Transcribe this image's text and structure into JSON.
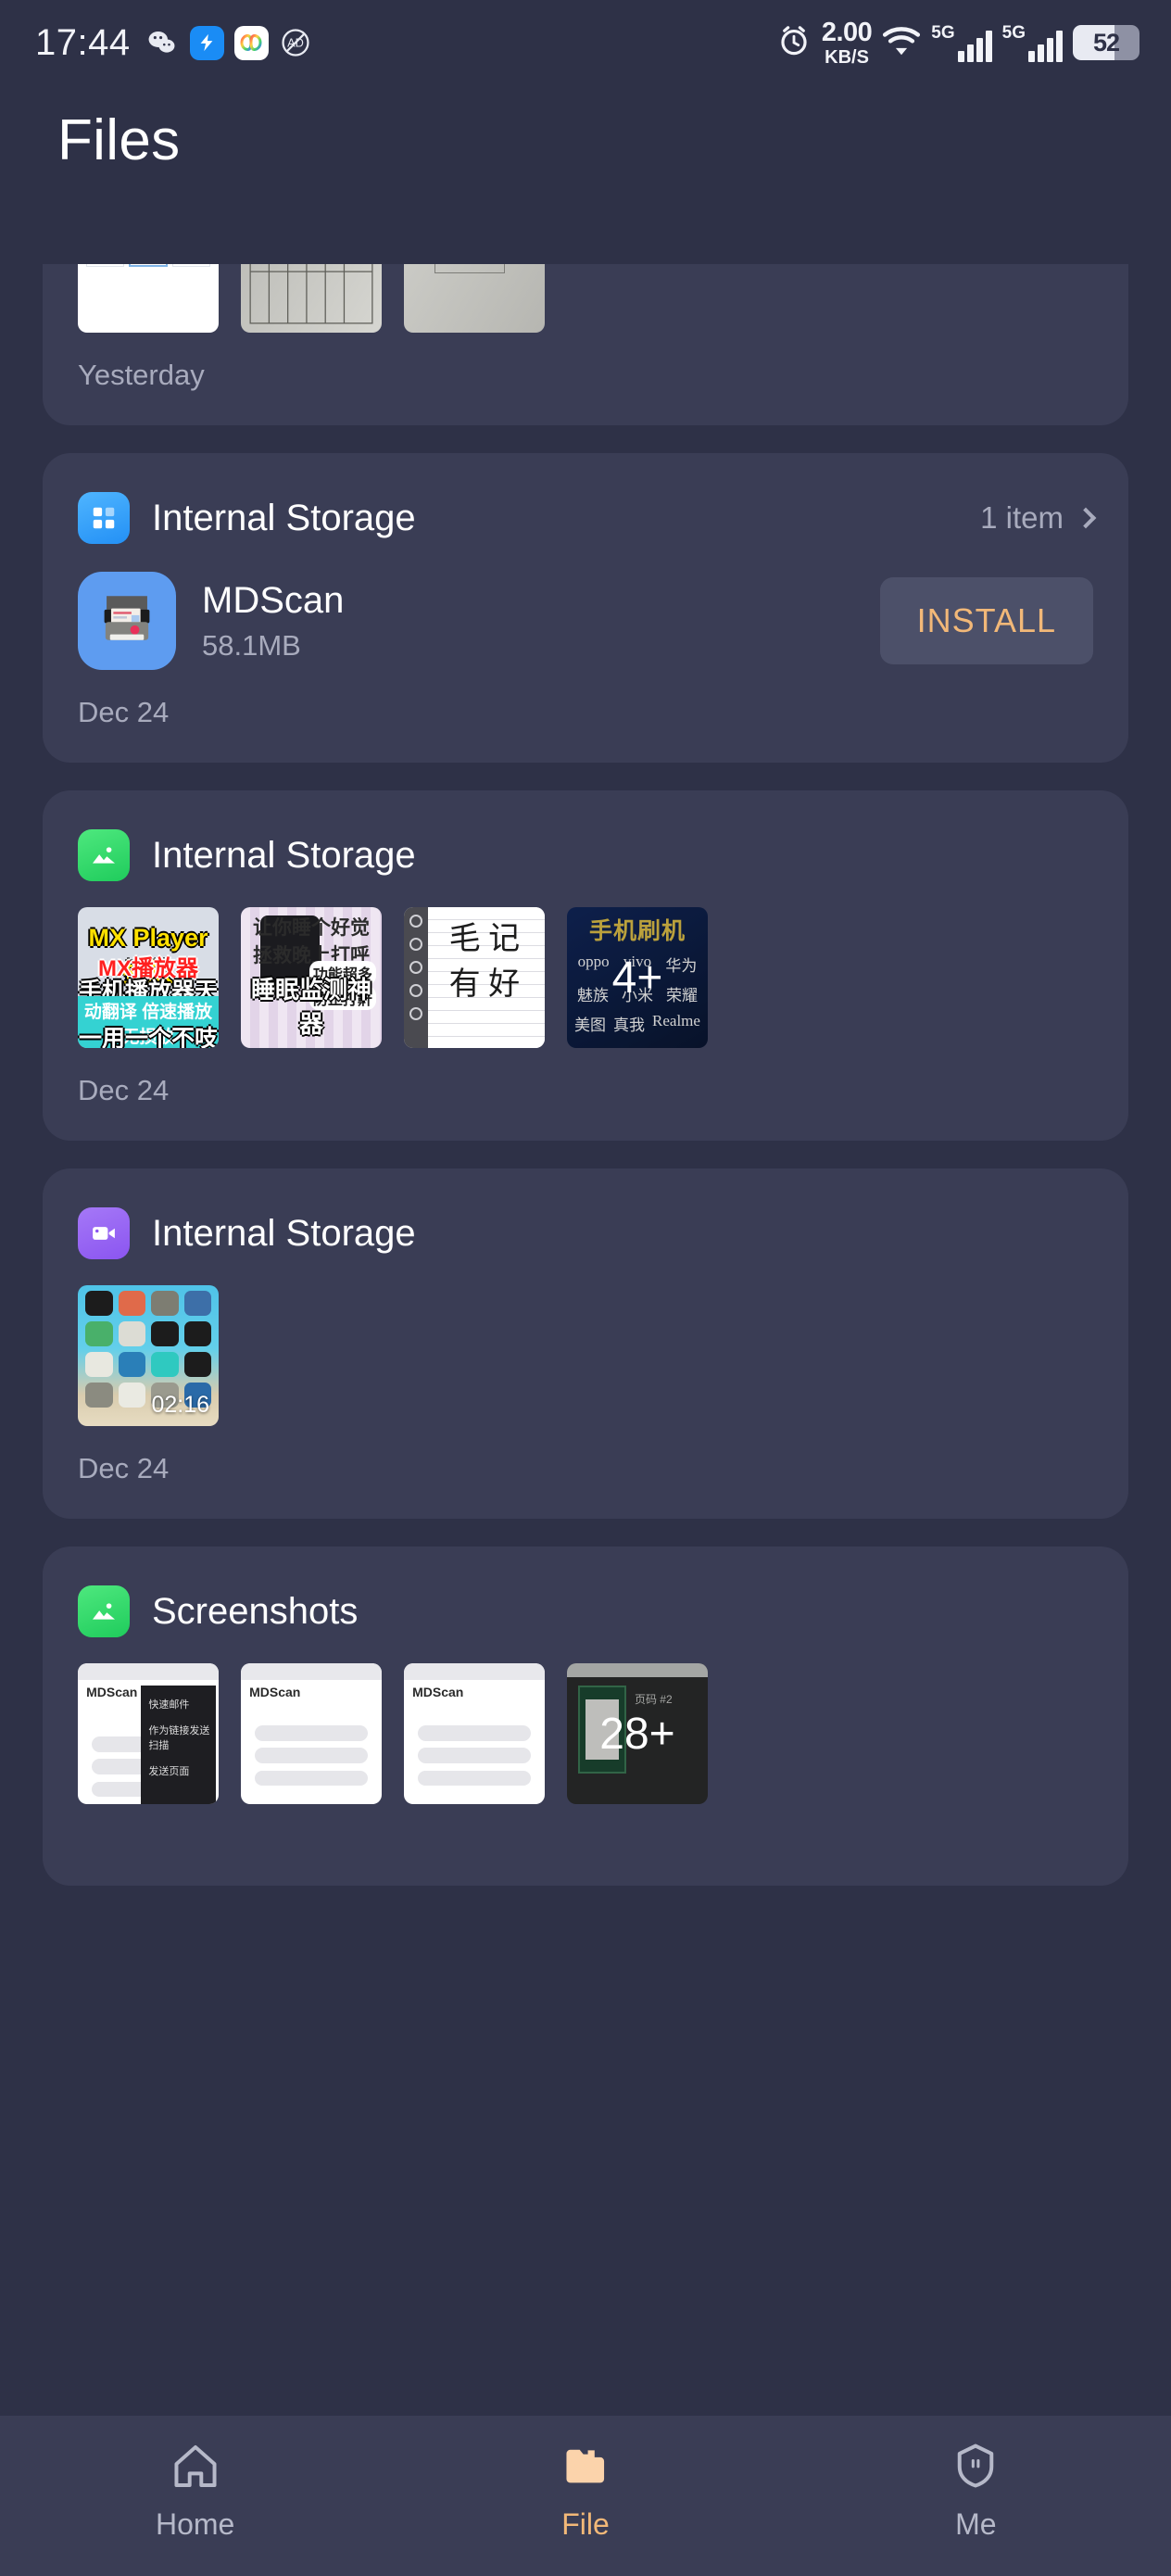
{
  "status_bar": {
    "time": "17:44",
    "app_icons": [
      "wechat-icon",
      "blue-bolt-app-icon",
      "colorful-app-icon",
      "adblock-icon"
    ],
    "alarm_icon": "alarm-clock-icon",
    "network_speed_value": "2.00",
    "network_speed_unit": "KB/S",
    "wifi_icon": "wifi-icon",
    "sim1_label": "5G",
    "sim2_label": "5G",
    "battery_percent": "52"
  },
  "header": {
    "title": "Files"
  },
  "sections": [
    {
      "id": "yesterday-card",
      "partial": true,
      "date_label": "Yesterday",
      "thumbnails": [
        {
          "kind": "doc-compare",
          "label": ""
        },
        {
          "kind": "scanned-form",
          "label": ""
        },
        {
          "kind": "scanned-paper",
          "label": ""
        }
      ]
    },
    {
      "id": "internal-storage-apk",
      "icon": "apps-grid-icon",
      "icon_color": "#2f97f3",
      "title": "Internal Storage",
      "meta_count": "1 item",
      "chevron": "chevron-right-icon",
      "app": {
        "icon": "scanner-icon",
        "name": "MDScan",
        "size": "58.1MB",
        "action_label": "INSTALL"
      },
      "date_label": "Dec 24"
    },
    {
      "id": "internal-storage-images",
      "icon": "image-mountain-icon",
      "icon_color": "#2ed762",
      "title": "Internal Storage",
      "date_label": "Dec 24",
      "thumbnails": [
        {
          "kind": "mx-player-promo",
          "lines": [
            "MX Player播放",
            "MX播放器",
            "手机播放器天花板",
            "动翻译 倍速播放 无损放",
            "一用一个不吱声"
          ]
        },
        {
          "kind": "sleep-promo",
          "header": "让你睡个好觉 拯救晚上打呼",
          "tags": [
            "功能超多",
            "防止打鼾"
          ],
          "footer": "睡眠监测神器"
        },
        {
          "kind": "handwriting-note",
          "ink": "毛 记 有 好"
        },
        {
          "kind": "flash-promo",
          "title": "手机刷机",
          "brands": [
            "oppo",
            "vivo",
            "华为",
            "魅族",
            "小米",
            "荣耀",
            "美图",
            "真我",
            "Realme"
          ],
          "overlay": "4+"
        }
      ]
    },
    {
      "id": "internal-storage-video",
      "icon": "video-camera-icon",
      "icon_color": "#8b55f0",
      "title": "Internal Storage",
      "date_label": "Dec 24",
      "thumbnails": [
        {
          "kind": "home-screen-recording",
          "duration": "02:16"
        }
      ]
    },
    {
      "id": "screenshots",
      "icon": "image-mountain-icon",
      "icon_color": "#2ed762",
      "title": "Screenshots",
      "thumbnails": [
        {
          "kind": "mdscan-menu-screenshot",
          "brand": "MDScan",
          "menu_items": [
            "快速邮件",
            "作为链接发送扫描",
            "发送页面"
          ]
        },
        {
          "kind": "mdscan-screenshot",
          "brand": "MDScan"
        },
        {
          "kind": "mdscan-screenshot",
          "brand": "MDScan"
        },
        {
          "kind": "file-info-screenshot",
          "title": "页码 #2",
          "overlay": "28+"
        }
      ]
    }
  ],
  "bottom_nav": {
    "items": [
      {
        "id": "home",
        "icon": "house-icon",
        "label": "Home",
        "active": false
      },
      {
        "id": "file",
        "icon": "folder-icon",
        "label": "File",
        "active": true
      },
      {
        "id": "me",
        "icon": "person-shield-icon",
        "label": "Me",
        "active": false
      }
    ]
  },
  "colors": {
    "background": "#2e3147",
    "card": "#3a3d55",
    "accent": "#f2b878",
    "muted_text": "#a8abbd"
  }
}
